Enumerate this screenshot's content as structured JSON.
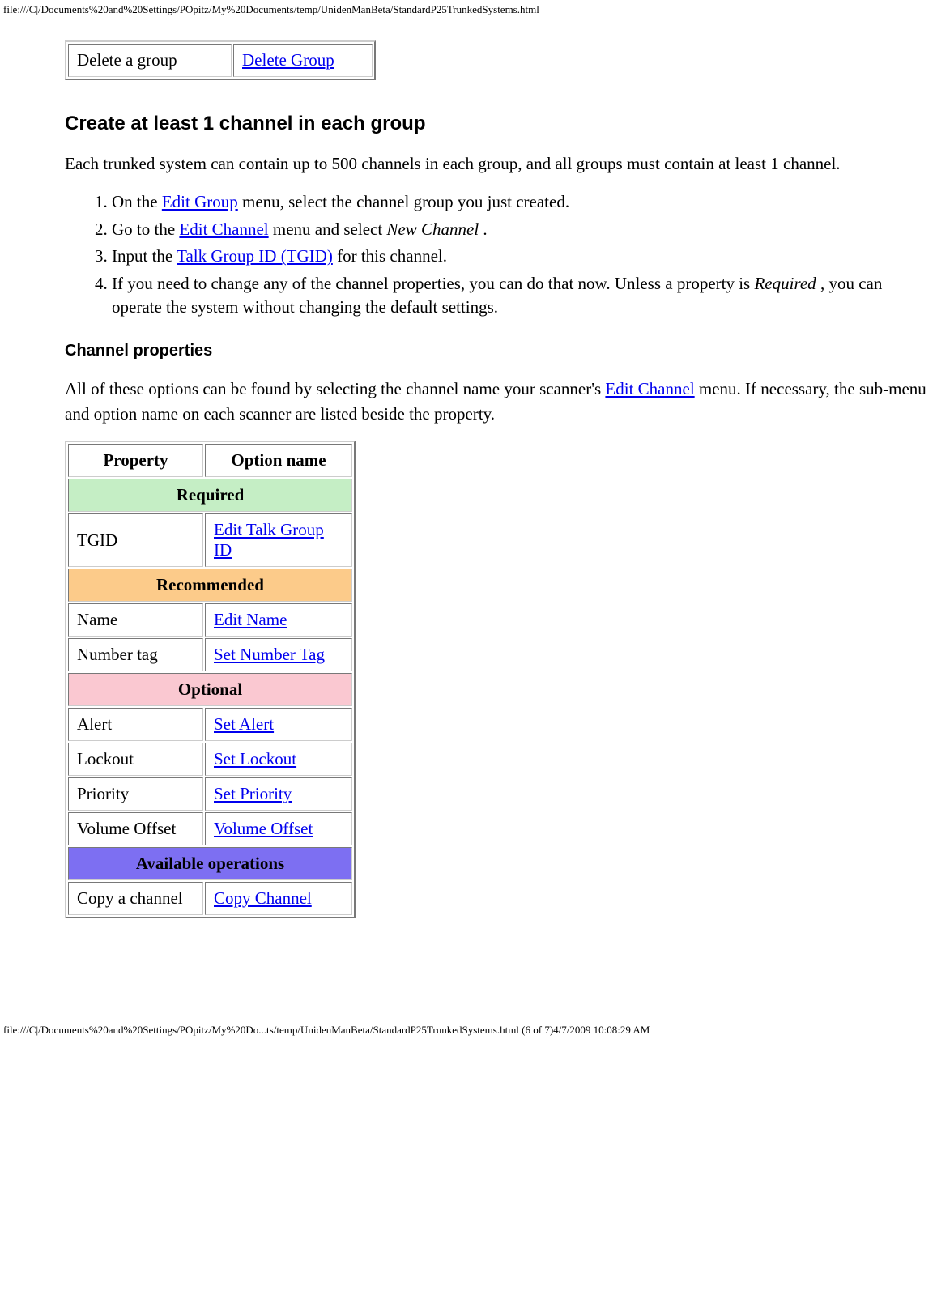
{
  "header_path": "file:///C|/Documents%20and%20Settings/POpitz/My%20Documents/temp/UnidenManBeta/StandardP25TrunkedSystems.html",
  "footer_path": "file:///C|/Documents%20and%20Settings/POpitz/My%20Do...ts/temp/UnidenManBeta/StandardP25TrunkedSystems.html (6 of 7)4/7/2009 10:08:29 AM",
  "top_table": {
    "row": {
      "label": "Delete a group",
      "link": "Delete Group"
    }
  },
  "heading": "Create at least 1 channel in each group",
  "intro": "Each trunked system can contain up to 500 channels in each group, and all groups must contain at least 1 channel.",
  "steps": {
    "s1a": "On the ",
    "s1_link": "Edit Group",
    "s1b": " menu, select the channel group you just created.",
    "s2a": "Go to the ",
    "s2_link": "Edit Channel",
    "s2b": " menu and select ",
    "s2_em": "New Channel",
    "s2c": " .",
    "s3a": "Input the ",
    "s3_link": "Talk Group ID (TGID)",
    "s3b": " for this channel.",
    "s4a": "If you need to change any of the channel properties, you can do that now. Unless a property is ",
    "s4_em": "Required",
    "s4b": " , you can operate the system without changing the default settings."
  },
  "subheading": "Channel properties",
  "subintro_a": "All of these options can be found by selecting the channel name your scanner's ",
  "subintro_link": "Edit Channel",
  "subintro_b": " menu. If necessary, the sub-menu and option name on each scanner are listed beside the property.",
  "table": {
    "h1": "Property",
    "h2": "Option name",
    "required": "Required",
    "recommended": "Recommended",
    "optional": "Optional",
    "operations": "Available operations",
    "rows": {
      "tgid": {
        "label": "TGID",
        "link": "Edit Talk Group ID"
      },
      "name": {
        "label": "Name",
        "link": "Edit Name"
      },
      "numtag": {
        "label": "Number tag",
        "link": "Set Number Tag"
      },
      "alert": {
        "label": "Alert",
        "link": "Set Alert"
      },
      "lockout": {
        "label": "Lockout",
        "link": "Set Lockout"
      },
      "priority": {
        "label": "Priority",
        "link": "Set Priority"
      },
      "volume": {
        "label": "Volume Offset",
        "link": "Volume Offset"
      },
      "copy": {
        "label": "Copy a channel",
        "link": "Copy Channel"
      }
    }
  }
}
